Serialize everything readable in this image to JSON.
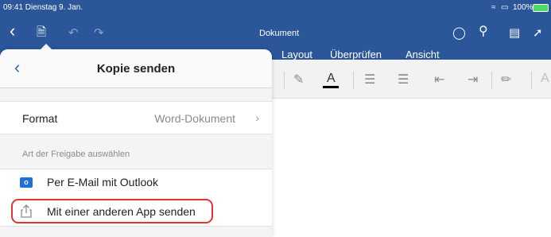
{
  "status_bar": {
    "time_date": "09:41  Dienstag 9. Jan.",
    "battery": "100%"
  },
  "toolbar": {
    "document_title": "Dokument",
    "icons": [
      "back-chevron-icon",
      "file-icon",
      "undo-icon",
      "redo-icon",
      "lightbulb-icon",
      "search-icon",
      "document-view-icon",
      "share-icon"
    ]
  },
  "tabs": [
    {
      "label": "Layout"
    },
    {
      "label": "Überprüfen"
    },
    {
      "label": "Ansicht"
    }
  ],
  "ribbon": {
    "icons": [
      "eraser-icon",
      "font-color-icon",
      "bulleted-list-icon",
      "numbered-list-icon",
      "decrease-indent-icon",
      "increase-indent-icon",
      "styles-icon",
      "text-styles-icon"
    ],
    "font_color_glyph": "A",
    "font_color_accent": "#000000"
  },
  "popover": {
    "title": "Kopie senden",
    "format_row": {
      "label": "Format",
      "value": "Word-Dokument"
    },
    "section_header": "Art der Freigabe auswählen",
    "share_options": [
      {
        "label": "Per E-Mail mit Outlook",
        "icon": "outlook-icon",
        "icon_text": "o"
      },
      {
        "label": "Mit einer anderen App senden",
        "icon": "share-icon",
        "highlighted": true
      }
    ]
  },
  "colors": {
    "word_blue": "#2b579a",
    "highlight_red": "#e3342f",
    "outlook_blue": "#1e6fd9"
  }
}
